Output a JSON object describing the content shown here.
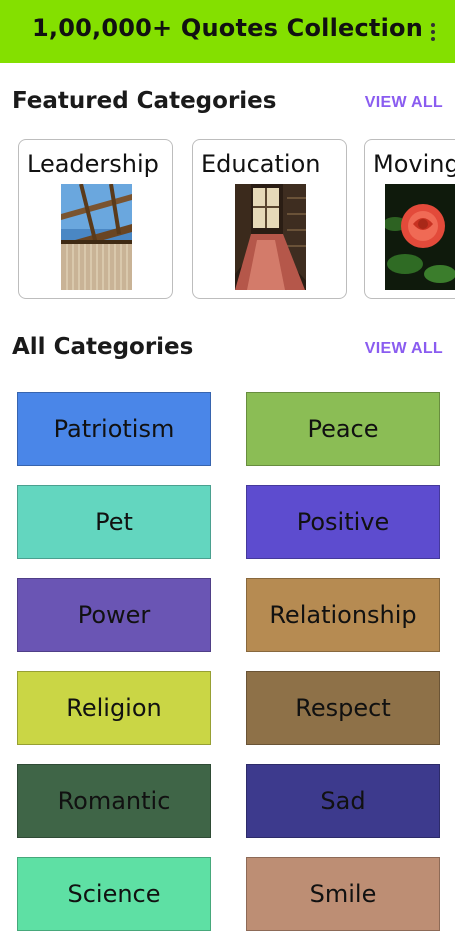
{
  "appbar": {
    "title": "1,00,000+ Quotes Collection",
    "menu_icon": "more-vert-icon"
  },
  "featured": {
    "heading": "Featured Categories",
    "view_all": "VIEW ALL",
    "cards": [
      {
        "label": "Leadership"
      },
      {
        "label": "Education"
      },
      {
        "label": "Moving"
      }
    ]
  },
  "all": {
    "heading": "All Categories",
    "view_all": "VIEW ALL",
    "items": [
      {
        "label": "Patriotism",
        "color": "#4a86e8"
      },
      {
        "label": "Peace",
        "color": "#8bbd55"
      },
      {
        "label": "Pet",
        "color": "#63d6bf"
      },
      {
        "label": "Positive",
        "color": "#5d4ccf"
      },
      {
        "label": "Power",
        "color": "#6a55b4"
      },
      {
        "label": "Relationship",
        "color": "#b68b52"
      },
      {
        "label": "Religion",
        "color": "#cad645"
      },
      {
        "label": "Respect",
        "color": "#8e7148"
      },
      {
        "label": "Romantic",
        "color": "#3f6547"
      },
      {
        "label": "Sad",
        "color": "#3d3a8d"
      },
      {
        "label": "Science",
        "color": "#5ee0a4"
      },
      {
        "label": "Smile",
        "color": "#bd8e74"
      }
    ]
  }
}
